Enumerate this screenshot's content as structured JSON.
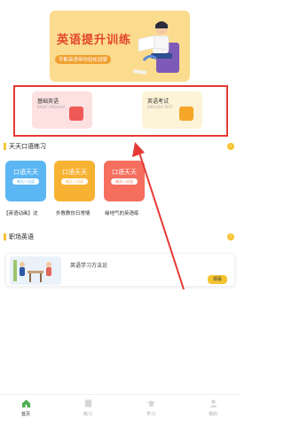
{
  "banner": {
    "title": "英语提升训练",
    "subtitle": "字斯英语带你轻松测掌"
  },
  "cards": [
    {
      "title": "基础英语",
      "subtitle": "BASIC ENGLISH"
    },
    {
      "title": "英语考试",
      "subtitle": "ENGLISH TEST"
    }
  ],
  "section_practice": {
    "title": "天天口语练习",
    "tiles": [
      {
        "label": "口语天天",
        "pill": "每天一点读",
        "caption": "【英语动画】沈",
        "color": "#5cb6f3"
      },
      {
        "label": "口语天天",
        "pill": "每天一点读",
        "caption": "外教教你日常情",
        "color": "#f8b232"
      },
      {
        "label": "口语天天",
        "pill": "每天一点读",
        "caption": "缘地气的英语练",
        "color": "#f56e5e"
      }
    ]
  },
  "section_work": {
    "title": "职场英语",
    "item_title": "英语学习方法论",
    "button": "观看"
  },
  "tabs": [
    {
      "label": "首页",
      "icon": "home-icon",
      "active": true
    },
    {
      "label": "练习",
      "icon": "book-icon",
      "active": false
    },
    {
      "label": "学习",
      "icon": "hat-icon",
      "active": false
    },
    {
      "label": "我的",
      "icon": "user-icon",
      "active": false
    }
  ],
  "colors": {
    "accent": "#f6c330",
    "highlight": "#e53935",
    "active_tab": "#4caf50"
  }
}
